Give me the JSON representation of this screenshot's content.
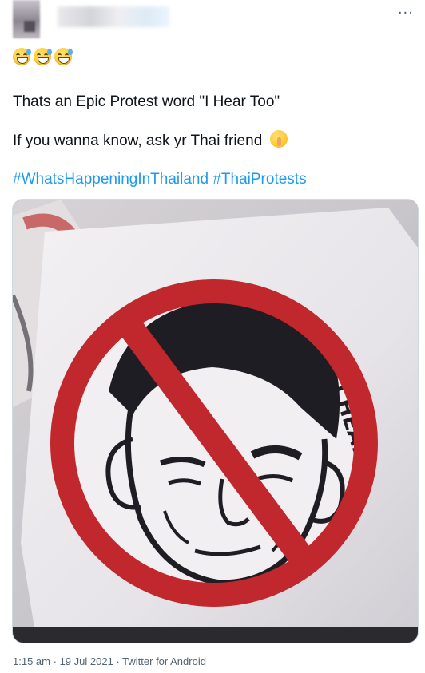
{
  "header": {
    "more_label": "···"
  },
  "emojis": [
    "sweat-smile",
    "sweat-smile",
    "sweat-smile"
  ],
  "tweet": {
    "line1": "Thats an Epic Protest word \"I Hear Too\"",
    "line2": "If you wanna know, ask yr Thai friend",
    "line2_emoji": "shushing-face",
    "hashtags": [
      "#WhatsHappeningInThailand",
      "#ThaiProtests"
    ]
  },
  "media": {
    "sticker_text": "I HEAR TOO"
  },
  "meta": {
    "time": "1:15 am",
    "date": "19 Jul 2021",
    "source": "Twitter for Android",
    "separator": "·"
  },
  "colors": {
    "hashtag": "#1d9bf0",
    "meta_text": "#536471",
    "sign_red": "#c0282e"
  }
}
